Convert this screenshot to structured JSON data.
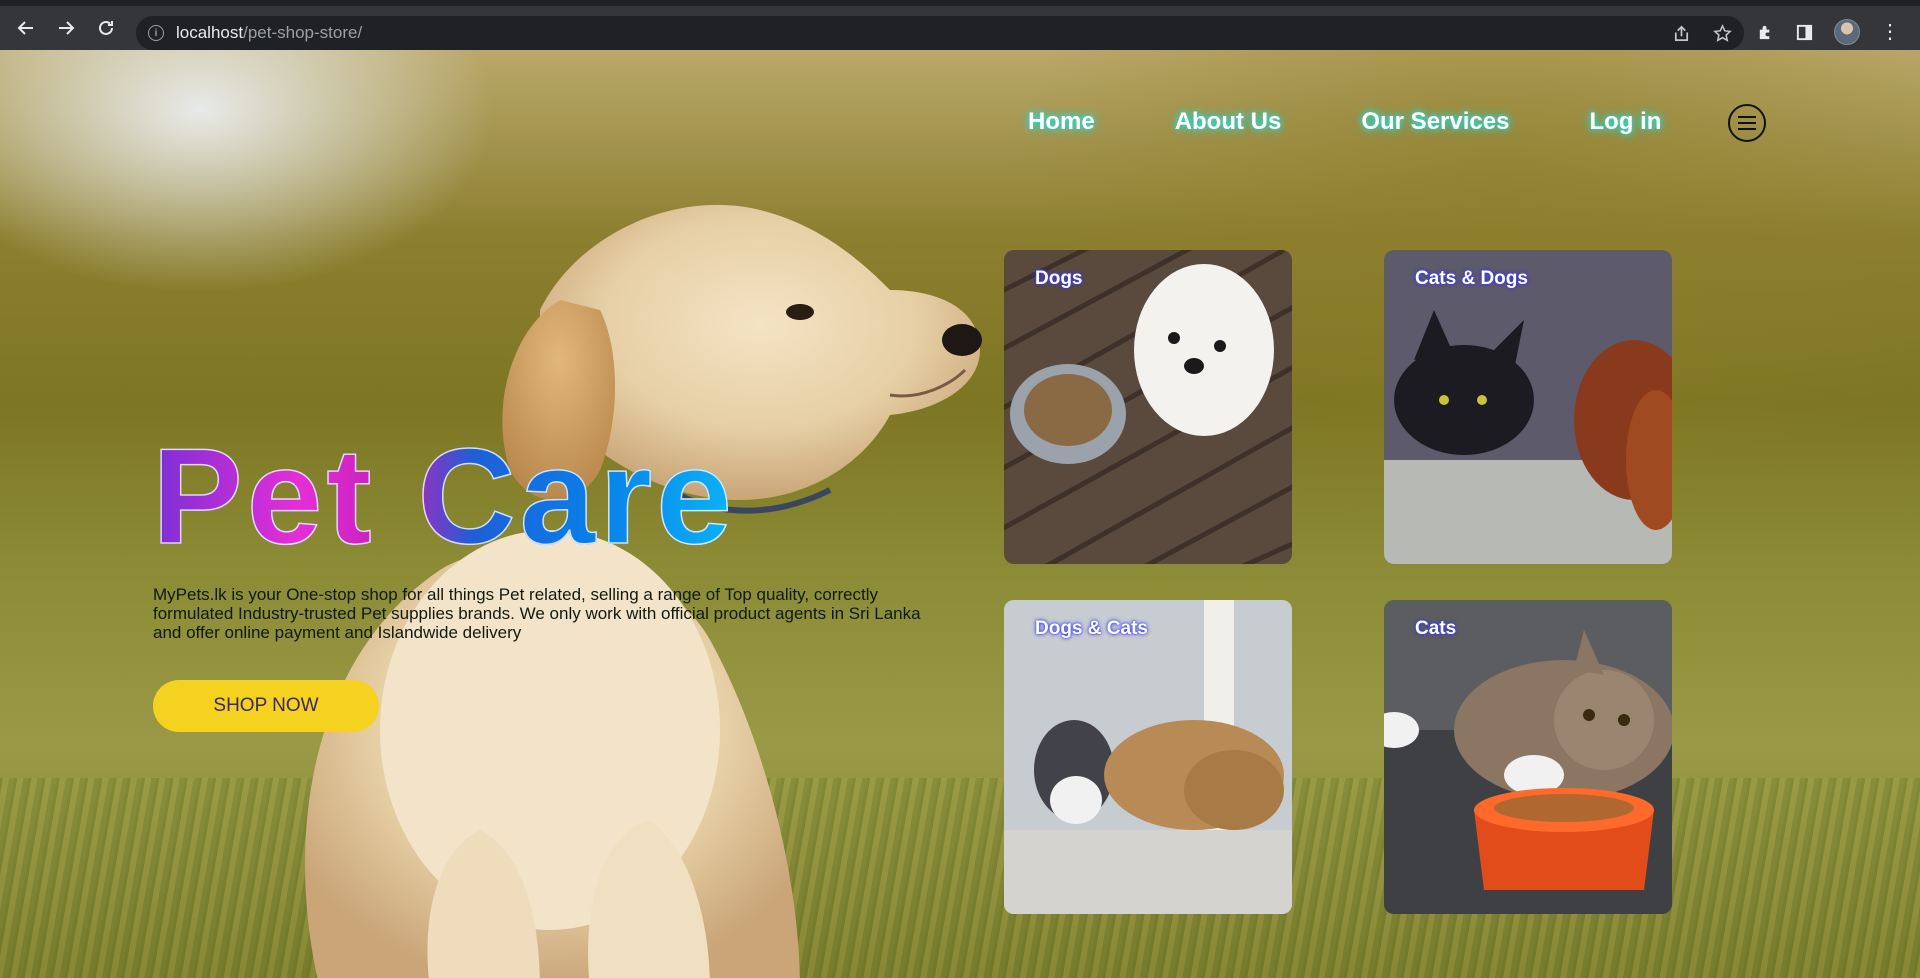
{
  "browser": {
    "url_host": "localhost",
    "url_path": "/pet-shop-store/"
  },
  "nav": {
    "items": [
      "Home",
      "About Us",
      "Our Services",
      "Log in"
    ]
  },
  "hero": {
    "title": "Pet Care",
    "description": "MyPets.lk is your One-stop shop for all things Pet related, selling a range of Top quality, correctly formulated Industry-trusted Pet supplies brands. We only work with official product agents in Sri Lanka and offer online payment and Islandwide delivery",
    "button": "SHOP NOW"
  },
  "cards": [
    {
      "label": "Dogs"
    },
    {
      "label": "Cats & Dogs"
    },
    {
      "label": "Dogs & Cats"
    },
    {
      "label": "Cats"
    }
  ],
  "colors": {
    "button_bg": "#f5d21f",
    "nav_glow": "#22e0d8"
  }
}
